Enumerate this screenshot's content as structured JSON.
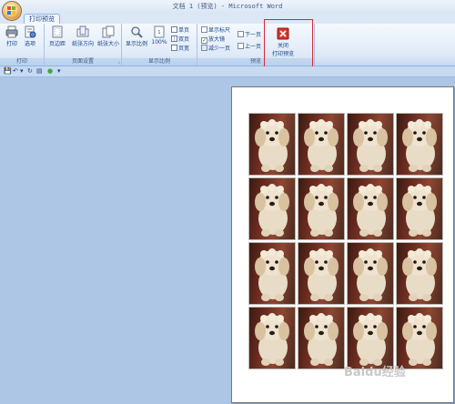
{
  "window": {
    "title": "文档 1 (预览) - Microsoft Word"
  },
  "ribbon": {
    "active_tab": "打印预览",
    "groups": [
      {
        "label": "打印"
      },
      {
        "label": "页面设置"
      },
      {
        "label": "显示比例"
      },
      {
        "label": "预览"
      }
    ],
    "print_group": {
      "print": "打印",
      "options": "选项"
    },
    "page_setup": {
      "margins": "页边距",
      "orientation": "纸张方向",
      "size": "纸张大小"
    },
    "zoom_group": {
      "zoom": "显示比例",
      "percent": "100%",
      "one_page": "单页",
      "two_pages": "双页",
      "page_width": "页宽"
    },
    "preview_group": {
      "show_ruler": "显示标尺",
      "magnifier": "放大镜",
      "shrink_one_page": "减少一页",
      "next_page": "下一页",
      "prev_page": "上一页",
      "close_line1": "关闭",
      "close_line2": "打印预览"
    }
  },
  "checkbox_state": {
    "show_ruler": false,
    "magnifier": true
  },
  "document": {
    "photo_rows": 4,
    "photo_cols": 4
  },
  "watermark": {
    "text": "Baidu经验"
  },
  "colors": {
    "highlight_box": "#d6283c",
    "workspace": "#adc6e5",
    "ribbon_text": "#15428b"
  }
}
